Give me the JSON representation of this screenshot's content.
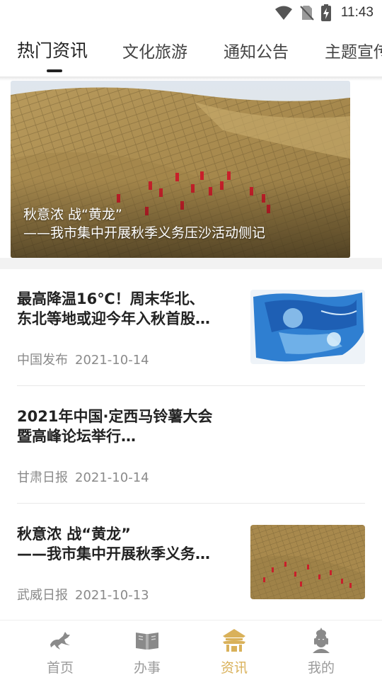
{
  "status_bar": {
    "time": "11:43"
  },
  "tabs": [
    {
      "label": "热门资讯",
      "active": true
    },
    {
      "label": "文化旅游",
      "active": false
    },
    {
      "label": "通知公告",
      "active": false
    },
    {
      "label": "主题宣传",
      "active": false
    }
  ],
  "banner": {
    "caption_line1": "秋意浓 战“黄龙”",
    "caption_line2": "——我市集中开展秋季义务压沙活动侧记"
  },
  "news": [
    {
      "title_line1": "最高降温16℃！周末华北、",
      "title_line2": "东北等地或迎今年入秋首股…",
      "source": "中国发布",
      "date": "2021-10-14",
      "has_thumb": true
    },
    {
      "title_line1": "2021年中国·定西马铃薯大会",
      "title_line2": "暨高峰论坛举行…",
      "source": "甘肃日报",
      "date": "2021-10-14",
      "has_thumb": false
    },
    {
      "title_line1": "秋意浓 战“黄龙”",
      "title_line2": "——我市集中开展秋季义务…",
      "source": "武威日报",
      "date": "2021-10-13",
      "has_thumb": true
    }
  ],
  "bottom_nav": [
    {
      "label": "首页",
      "icon": "horse-icon",
      "active": false
    },
    {
      "label": "办事",
      "icon": "book-icon",
      "active": false
    },
    {
      "label": "资讯",
      "icon": "pavilion-icon",
      "active": true
    },
    {
      "label": "我的",
      "icon": "buddha-icon",
      "active": false
    }
  ],
  "colors": {
    "accent": "#d9b15a",
    "inactive": "#9b9b9b"
  }
}
